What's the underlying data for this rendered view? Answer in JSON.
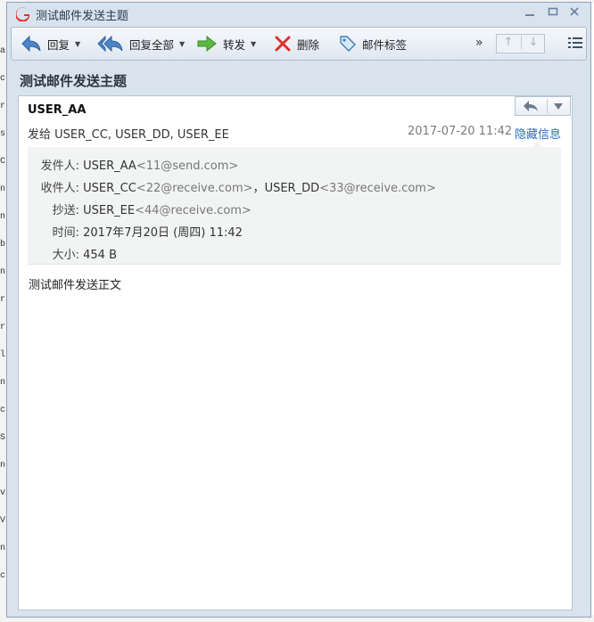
{
  "window": {
    "title": "测试邮件发送主题",
    "brand_color": "#e0322a"
  },
  "toolbar": {
    "reply": "回复",
    "reply_all": "回复全部",
    "forward": "转发",
    "delete": "删除",
    "mail_tag": "邮件标签",
    "more": "»"
  },
  "message": {
    "subject": "测试邮件发送主题",
    "sender_name": "USER_AA",
    "sent_to_line": "发给 USER_CC, USER_DD, USER_EE",
    "date": "2017-07-20 11:42",
    "hide_info": "隐藏信息",
    "details": {
      "from_label": "发件人:",
      "from_name": "USER_AA",
      "from_addr": "<11@send.com>",
      "to_label": "收件人:",
      "to_1_name": "USER_CC",
      "to_1_addr": "<22@receive.com>",
      "to_sep": "，",
      "to_2_name": "USER_DD",
      "to_2_addr": "<33@receive.com>",
      "cc_label": "抄送:",
      "cc_name": "USER_EE",
      "cc_addr": "<44@receive.com>",
      "time_label": "时间:",
      "time_value": "2017年7月20日 (周四) 11:42",
      "size_label": "大小:",
      "size_value": "454 B"
    },
    "body": "测试邮件发送正文"
  },
  "background_fragments": [
    "a",
    "c",
    "r",
    "s",
    "C",
    "n",
    "n",
    "b",
    "n",
    "r",
    "r",
    "l",
    "n",
    "c",
    "S",
    "n",
    "vi",
    "V",
    "n",
    "c"
  ]
}
